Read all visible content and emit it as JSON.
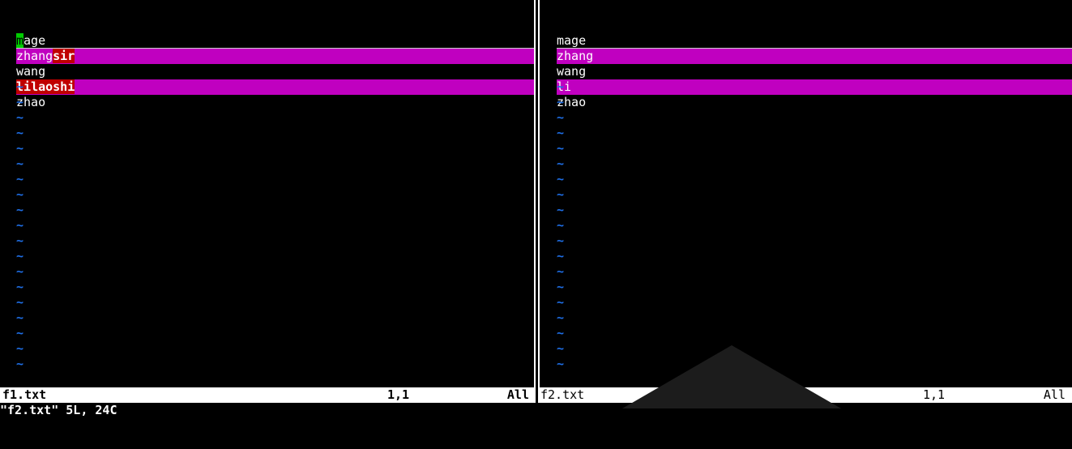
{
  "app": "vimdiff",
  "panes": {
    "left": {
      "lines": [
        {
          "text": "mage",
          "diff": false,
          "cursor_char": "m",
          "rest": "age"
        },
        {
          "text": "zhangsir",
          "diff": true,
          "same": "zhang",
          "changed": "sir"
        },
        {
          "text": "wang",
          "diff": false
        },
        {
          "text": "lilaoshi",
          "diff": true,
          "same": "li",
          "changed": "laoshi"
        },
        {
          "text": "zhao",
          "diff": false
        }
      ],
      "status": {
        "filename": "f1.txt",
        "position": "1,1",
        "percent": "All"
      }
    },
    "right": {
      "lines": [
        {
          "text": "mage",
          "diff": false
        },
        {
          "text": "zhang",
          "diff": true
        },
        {
          "text": "wang",
          "diff": false
        },
        {
          "text": "li",
          "diff": true
        },
        {
          "text": "zhao",
          "diff": false
        }
      ],
      "status": {
        "filename": "f2.txt",
        "position": "1,1",
        "percent": "All"
      }
    }
  },
  "empty_line_marker": "~",
  "command_line": "\"f2.txt\" 5L, 24C",
  "colors": {
    "diff_change_bg": "#c000c0",
    "diff_text_bg": "#c00000",
    "cursor_bg": "#00cc00",
    "tilde": "#1e6ee6",
    "status_bg": "#ffffff"
  }
}
